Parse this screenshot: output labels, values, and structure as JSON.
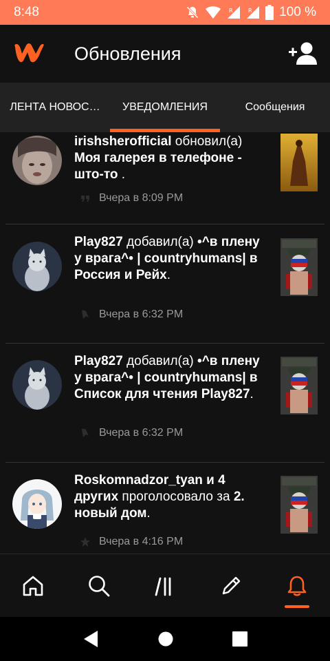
{
  "status_bar": {
    "time": "8:48",
    "battery": "100 %"
  },
  "app_bar": {
    "title": "Обновления",
    "logo_icon": "wattpad-logo",
    "action_icon": "add-user-icon"
  },
  "tabs": [
    {
      "label": "ЛЕНТА НОВОС…",
      "active": false
    },
    {
      "label": "УВЕДОМЛЕНИЯ",
      "active": true
    },
    {
      "label": "Сообщения",
      "active": false
    }
  ],
  "notifications": [
    {
      "user": "irishsherofficial",
      "action": " обновил(а) ",
      "story": "Моя галерея в телефоне - што-то",
      "tail": " .",
      "time": "Вчера в 8:09 PM",
      "meta_icon": "quote-icon"
    },
    {
      "user": "Play827",
      "action": " добавил(а) ",
      "story": "•^в плену у врага^• | countryhumans| в Россия и Рейх",
      "tail": ".",
      "time": "Вчера в 6:32 PM",
      "meta_icon": "bookmark-icon"
    },
    {
      "user": "Play827",
      "action": " добавил(а) ",
      "story": "•^в плену у врага^• | countryhumans| в Список для чтения Play827",
      "tail": ".",
      "time": "Вчера в 6:32 PM",
      "meta_icon": "bookmark-icon"
    },
    {
      "user": "Roskomnadzor_tyan и 4 других",
      "action": " проголосовало за ",
      "story": "2. новый дом",
      "tail": ".",
      "time": "Вчера в 4:16 PM",
      "meta_icon": "star-icon"
    }
  ],
  "bottom_nav": [
    {
      "icon": "home-icon",
      "active": false
    },
    {
      "icon": "search-icon",
      "active": false
    },
    {
      "icon": "library-icon",
      "active": false
    },
    {
      "icon": "pencil-icon",
      "active": false
    },
    {
      "icon": "bell-icon",
      "active": true
    }
  ],
  "colors": {
    "accent": "#ff6122",
    "status_bar": "#ff7a56",
    "background": "#121212",
    "tabs_bg": "#222222"
  }
}
